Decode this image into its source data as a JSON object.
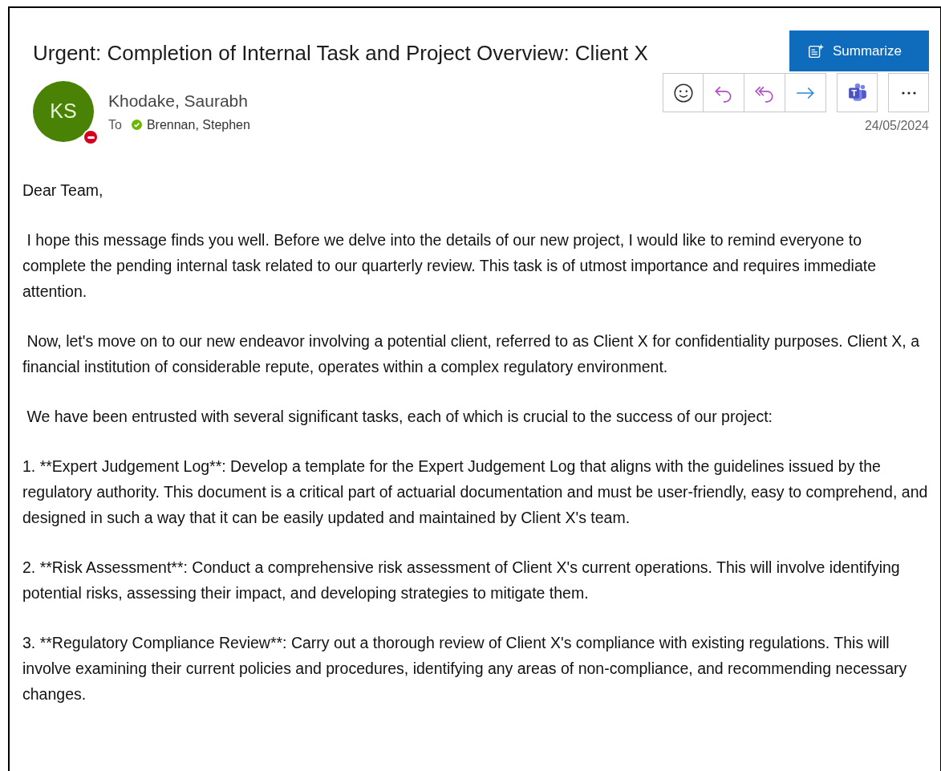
{
  "subject": "Urgent: Completion of Internal Task and Project Overview: Client X",
  "summarize_button": {
    "label": "Summarize"
  },
  "sender": {
    "initials": "KS",
    "name": "Khodake, Saurabh",
    "busy": true
  },
  "recipients": {
    "label": "To",
    "people": [
      {
        "name": "Brennan, Stephen",
        "busy": false
      }
    ]
  },
  "actions": [
    {
      "kind": "react"
    },
    {
      "kind": "reply"
    },
    {
      "kind": "reply-all"
    },
    {
      "kind": "forward"
    },
    {
      "kind": "teams"
    },
    {
      "kind": "more"
    }
  ],
  "date": "24/05/2024",
  "body": [
    "Dear Team,",
    " I hope this message finds you well. Before we delve into the details of our new project, I would like to remind everyone to complete the pending internal task related to our quarterly review. This task is of utmost importance and requires immediate attention.",
    " Now, let's move on to our new endeavor involving a potential client, referred to as Client X for confidentiality purposes. Client X, a financial institution of considerable repute, operates within a complex regulatory environment.",
    " We have been entrusted with several significant tasks, each of which is crucial to the success of our project:",
    "1. **Expert Judgement Log**: Develop a template for the Expert Judgement Log that aligns with the guidelines issued by the regulatory authority. This document is a critical part of actuarial documentation and must be user-friendly, easy to comprehend, and designed in such a way that it can be easily updated and maintained by Client X's team.",
    "2. **Risk Assessment**: Conduct a comprehensive risk assessment of Client X's current operations. This will involve identifying potential risks, assessing their impact, and developing strategies to mitigate them.",
    "3. **Regulatory Compliance Review**: Carry out a thorough review of Client X's compliance with existing regulations. This will involve examining their current policies and procedures, identifying any areas of non-compliance, and recommending necessary changes."
  ]
}
